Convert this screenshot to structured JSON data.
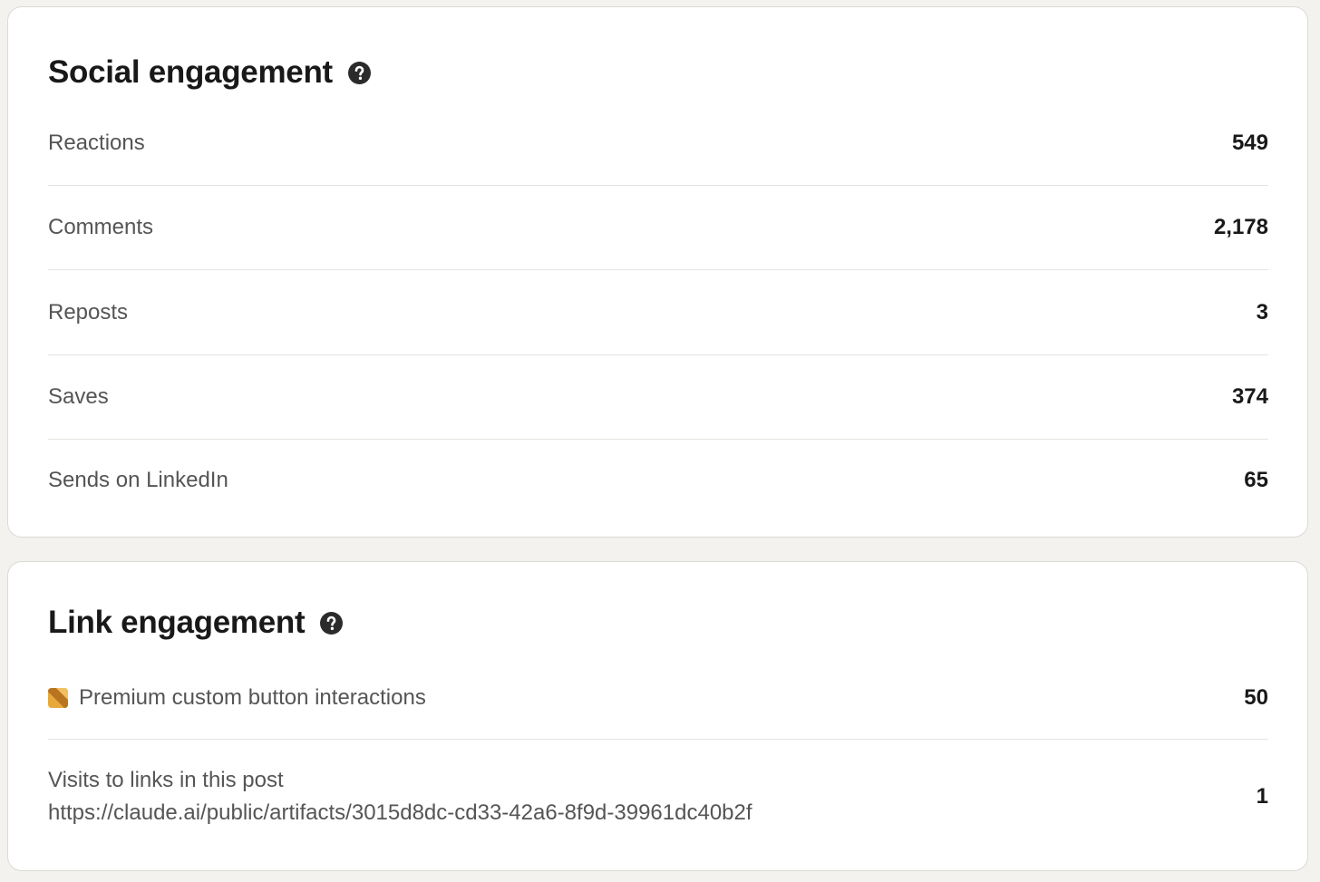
{
  "social_engagement": {
    "title": "Social engagement",
    "help_icon": "help-circle-icon",
    "metrics": [
      {
        "label": "Reactions",
        "value": "549"
      },
      {
        "label": "Comments",
        "value": "2,178"
      },
      {
        "label": "Reposts",
        "value": "3"
      },
      {
        "label": "Saves",
        "value": "374"
      },
      {
        "label": "Sends on LinkedIn",
        "value": "65"
      }
    ]
  },
  "link_engagement": {
    "title": "Link engagement",
    "help_icon": "help-circle-icon",
    "premium_row": {
      "icon": "premium-badge-icon",
      "label": "Premium custom button interactions",
      "value": "50"
    },
    "visits_row": {
      "label": "Visits to links in this post",
      "url": "https://claude.ai/public/artifacts/3015d8dc-cd33-42a6-8f9d-39961dc40b2f",
      "value": "1"
    }
  },
  "colors": {
    "page_background": "#f4f2ee",
    "card_background": "#ffffff",
    "title_text": "#191919",
    "label_text": "#555555",
    "premium_gold": "#d9962b"
  }
}
